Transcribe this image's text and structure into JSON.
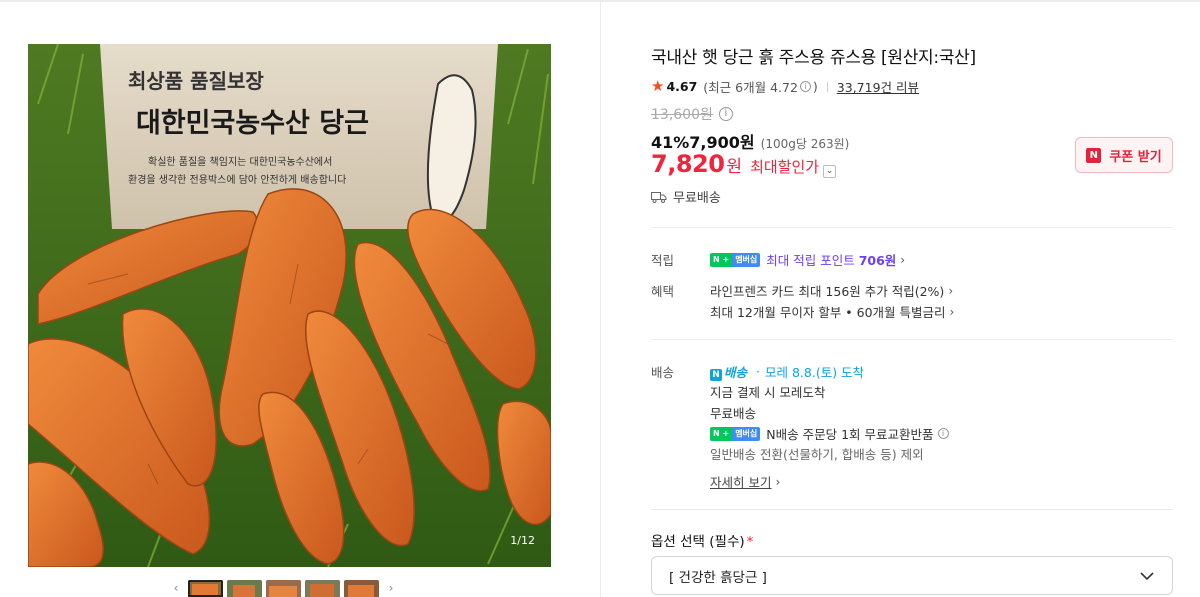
{
  "gallery": {
    "box_headline": "최상품 품질보장",
    "box_brand": "대한민국농수산 당근",
    "box_copy_line1": "확실한 품질을 책임지는 대한민국농수산에서",
    "box_copy_line2": "환경을 생각한 전용박스에 담아 안전하게 배송합니다",
    "counter": "1/12",
    "prev_arrow": "‹",
    "next_arrow": "›"
  },
  "product": {
    "title": "국내산 햇 당근 흙 주스용 쥬스용 [원산지:국산]",
    "rating": "4.67",
    "rating_recent": "(최근 6개월 4.72",
    "rating_recent_close": ")",
    "review_count": "33,719건 리뷰",
    "original_price": "13,600원",
    "discount_rate": "41%",
    "discount_price": "7,900원",
    "unit_price": "(100g당 263원)",
    "max_discount_price": "7,820",
    "max_discount_won": "원",
    "max_discount_label": "최대할인가",
    "coupon_label": "쿠폰 받기",
    "free_shipping": "무료배송"
  },
  "benefits": {
    "points_label": "적립",
    "membership_badge": "멤버십",
    "points_prefix": "최대 적립 포인트 ",
    "points_value": "706원",
    "perks_label": "혜택",
    "perk1": "라인프렌즈 카드 최대 156원 추가 적립(2%)",
    "perk2": "최대 12개월 무이자 할부 • 60개월 특별금리"
  },
  "delivery": {
    "label": "배송",
    "n_delivery": "배송",
    "arrival": "모레 8.8.(토) 도착",
    "line1": "지금 결제 시 모레도착",
    "line2": "무료배송",
    "line3": "N배송 주문당 1회 무료교환반품",
    "line4": "일반배송 전환(선물하기, 합배송 등) 제외",
    "details_link": "자세히 보기"
  },
  "option": {
    "label": "옵션 선택 (필수)",
    "required_mark": "*",
    "selected": "[  건강한 흙당근  ]"
  },
  "colors": {
    "accent_red": "#f0243d",
    "star": "#f04e23",
    "point_purple": "#6a3ff5",
    "delivery_blue": "#12a2d8",
    "naver_green": "#03c75a"
  }
}
